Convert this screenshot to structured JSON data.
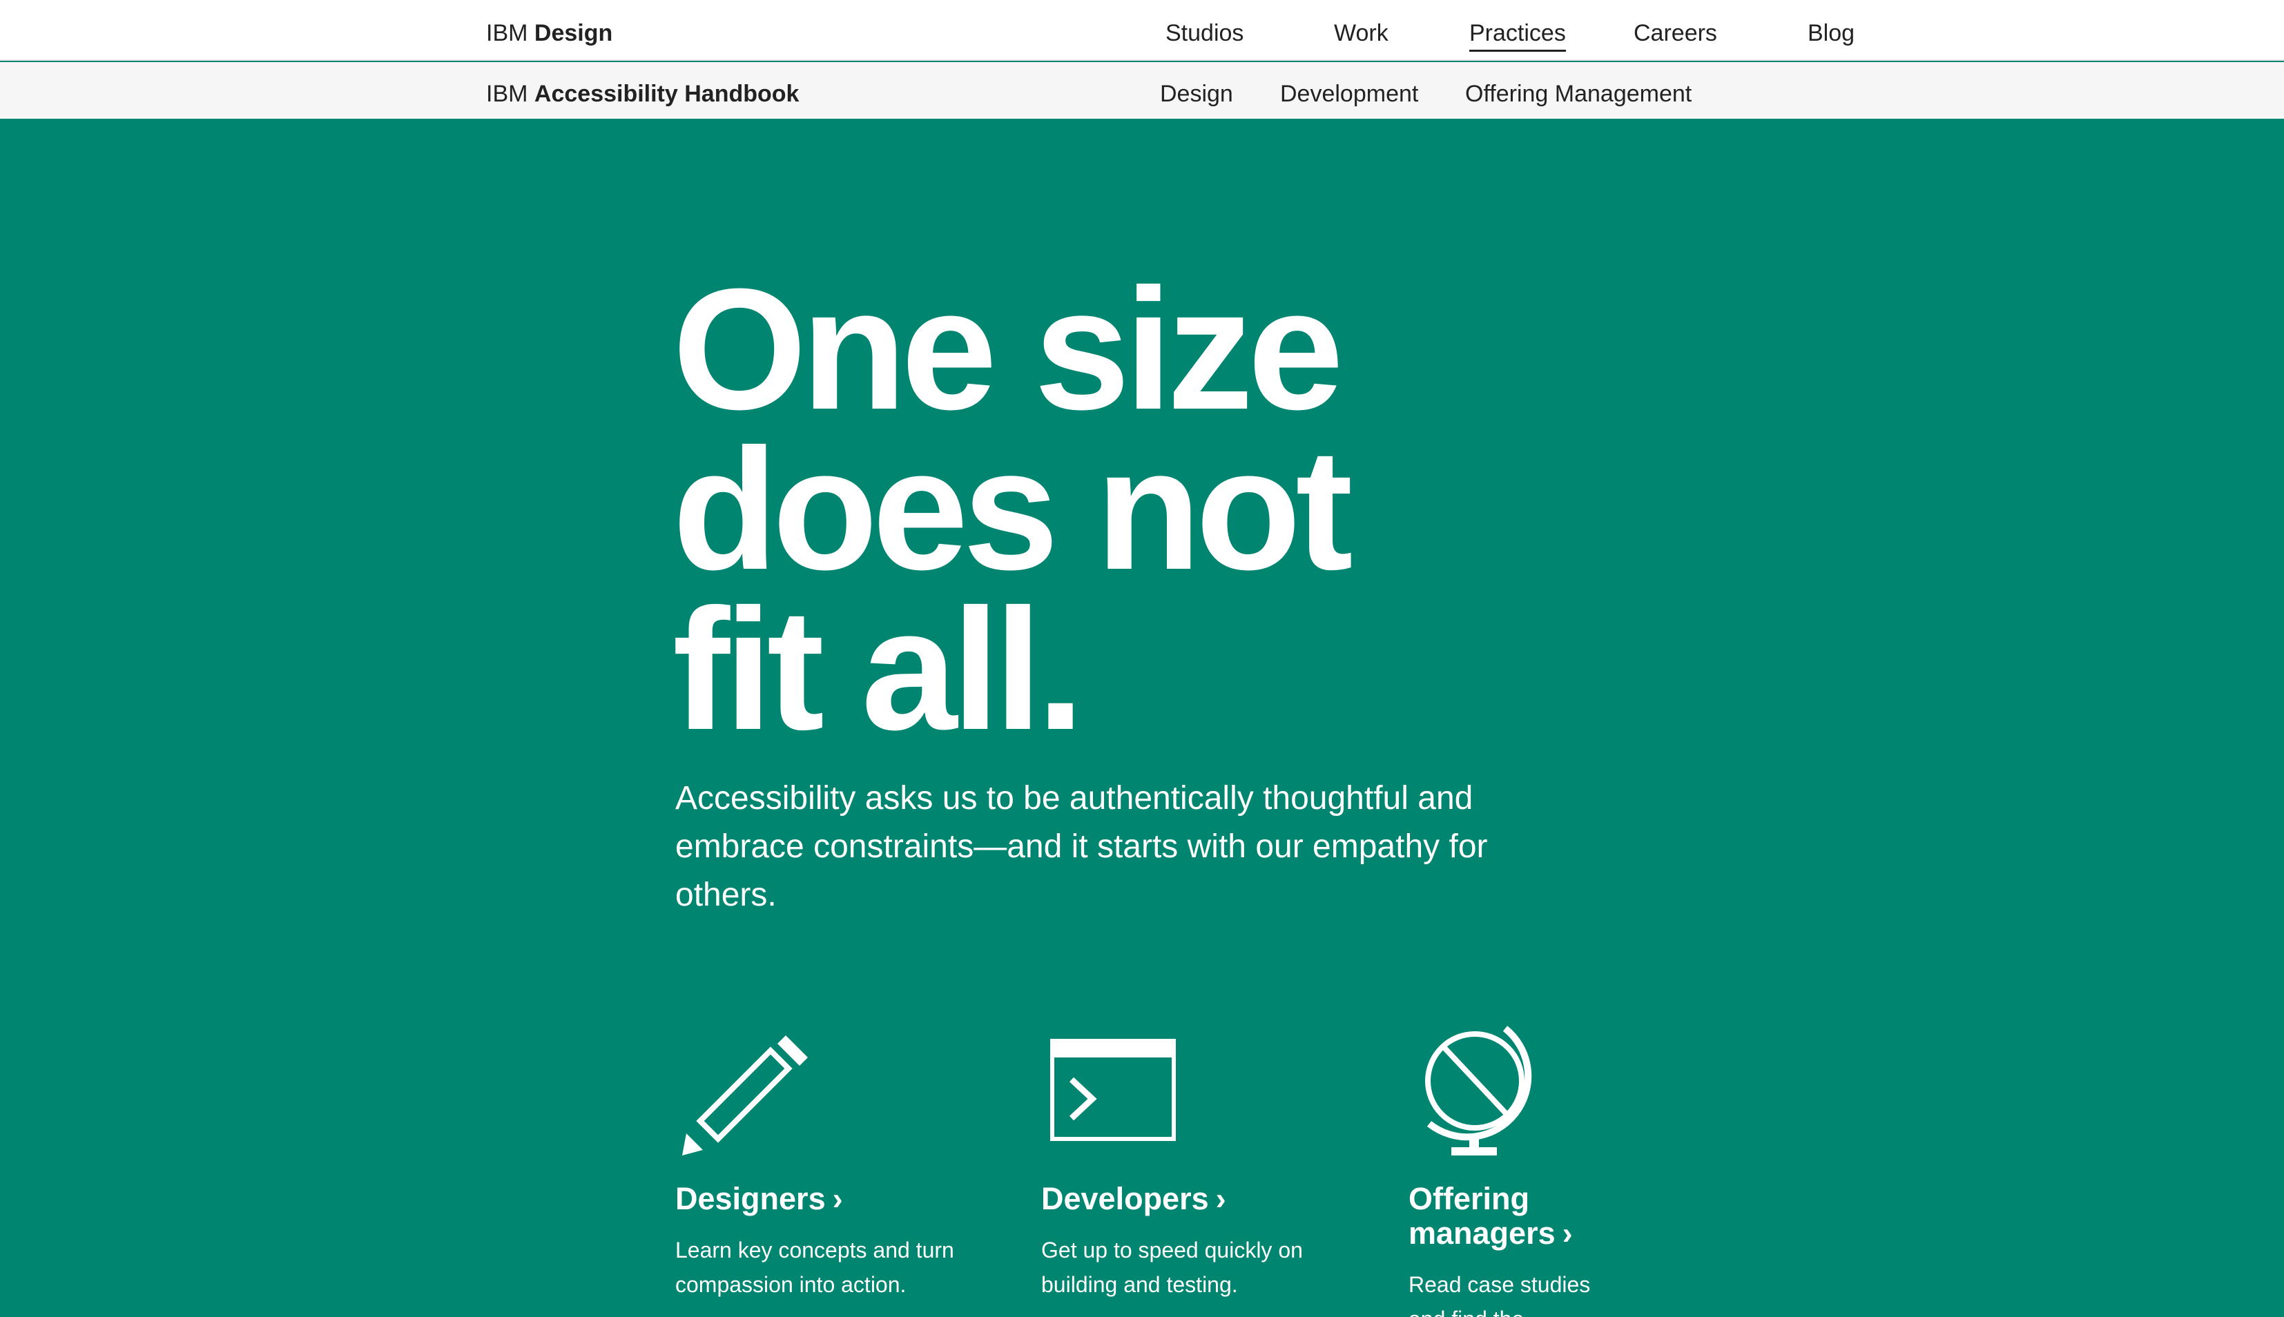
{
  "header": {
    "brand_prefix": "IBM",
    "brand_name": "Design",
    "nav": [
      "Studios",
      "Work",
      "Practices",
      "Careers",
      "Blog"
    ],
    "active": "Practices"
  },
  "subheader": {
    "brand_prefix": "IBM",
    "brand_name": "Accessibility Handbook",
    "nav": [
      "Design",
      "Development",
      "Offering Management"
    ]
  },
  "hero": {
    "title_lines": [
      "One size",
      "does not",
      "fit all."
    ],
    "subtitle": "Accessibility asks us to be authentically thoughtful and embrace constraints—and it starts with our empathy for others."
  },
  "cards": [
    {
      "icon": "pencil-icon",
      "title": "Designers",
      "chevron": "›",
      "desc": "Learn key concepts and turn compassion into action."
    },
    {
      "icon": "terminal-icon",
      "title": "Developers",
      "chevron": "›",
      "desc": "Get up to speed quickly on building and testing."
    },
    {
      "icon": "globe-icon",
      "title_line1": "Offering",
      "title_line2": "managers",
      "chevron": "›",
      "desc": "Read case studies and find the"
    }
  ],
  "colors": {
    "background": "#008571",
    "text": "#ffffff",
    "nav_text": "#222222"
  }
}
